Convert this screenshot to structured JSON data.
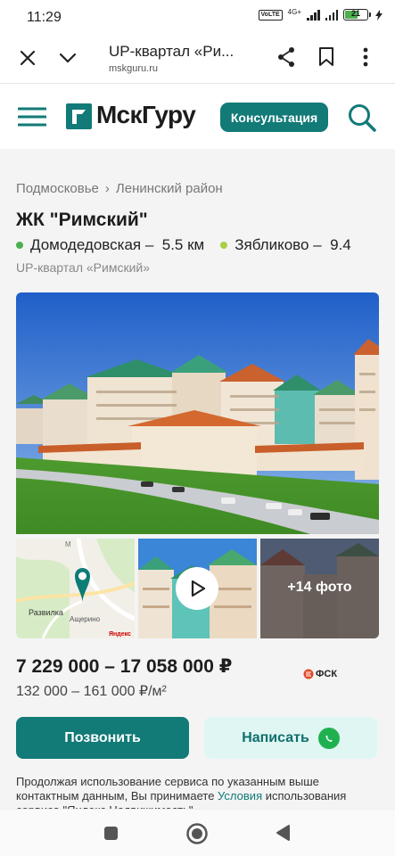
{
  "status_bar": {
    "time": "11:29",
    "volte": "VoLTE",
    "network": "4G+",
    "battery": "21",
    "battery_level": 0.21
  },
  "browser": {
    "tab_title": "UP-квартал «Ри...",
    "url": "mskguru.ru",
    "icons": [
      "close-icon",
      "chevron-down-icon",
      "share-icon",
      "bookmark-icon",
      "more-vert-icon"
    ]
  },
  "site_header": {
    "logo": "МскГуру",
    "consult_label": "Консультация",
    "icons": [
      "menu-icon",
      "search-icon"
    ]
  },
  "breadcrumb": {
    "items": [
      "Подмосковье",
      "Ленинский район"
    ],
    "separator": "›"
  },
  "listing": {
    "title": "ЖК \"Римский\"",
    "metro": [
      {
        "name": "Домодедовская –",
        "distance": "5.5 км",
        "color": "#4caf50"
      },
      {
        "name": "Зябликово –",
        "distance": "9.4",
        "color": "#a8cf45"
      }
    ],
    "subtitle": "UP-квартал «Римский»",
    "map_labels": {
      "place1": "Развилка",
      "place2": "Ащерино",
      "road": "М",
      "provider": "Яндекс"
    },
    "more_photos": "+14 фото",
    "price": "7 229 000 – 17 058 000 ₽",
    "price_per_m2": "132 000 – 161 000 ₽/м²",
    "developer": "ФСК"
  },
  "actions": {
    "call_label": "Позвонить",
    "write_label": "Написать"
  },
  "disclaimer": {
    "part1": "Продолжая использование сервиса по указанным выше контактным данным, Вы принимаете ",
    "link": "Условия",
    "part2": " использования сервиса \"Яндекс.Недвижимость\""
  },
  "colors": {
    "accent": "#127a77",
    "accent_light": "#e0f6f3",
    "whatsapp": "#1fb150"
  }
}
